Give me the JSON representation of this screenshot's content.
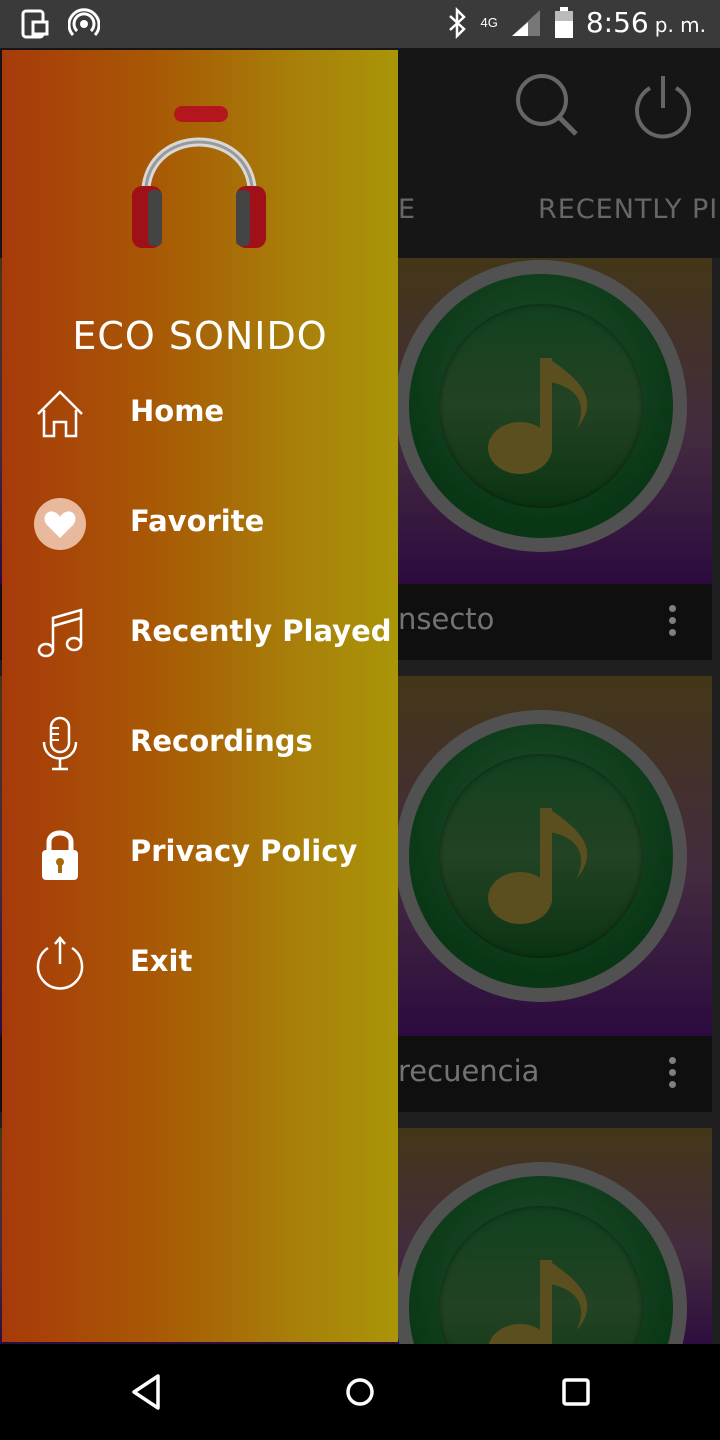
{
  "status_bar": {
    "time": "8:56",
    "ampm": "p. m.",
    "network": "4G",
    "icons": [
      "sim-storage-icon",
      "hotspot-icon",
      "bluetooth-icon",
      "network-4g-icon",
      "signal-icon",
      "battery-icon"
    ]
  },
  "app": {
    "tabs": [
      "E",
      "RECENTLY PI"
    ],
    "cards": [
      {
        "title": "nsecto"
      },
      {
        "title": "recuencia"
      },
      {
        "title": ""
      }
    ]
  },
  "drawer": {
    "app_name": "ECO SONIDO",
    "items": [
      {
        "label": "Home",
        "icon": "home-icon"
      },
      {
        "label": "Favorite",
        "icon": "heart-icon"
      },
      {
        "label": "Recently Played",
        "icon": "music-notes-icon"
      },
      {
        "label": "Recordings",
        "icon": "microphone-icon"
      },
      {
        "label": "Privacy Policy",
        "icon": "lock-icon"
      },
      {
        "label": "Exit",
        "icon": "power-icon"
      }
    ]
  },
  "colors": {
    "drawer_start": "#a83a0a",
    "drawer_end": "#aa9508",
    "status_bar": "#3a3a3a",
    "card_disc": "#0d4a1e"
  }
}
